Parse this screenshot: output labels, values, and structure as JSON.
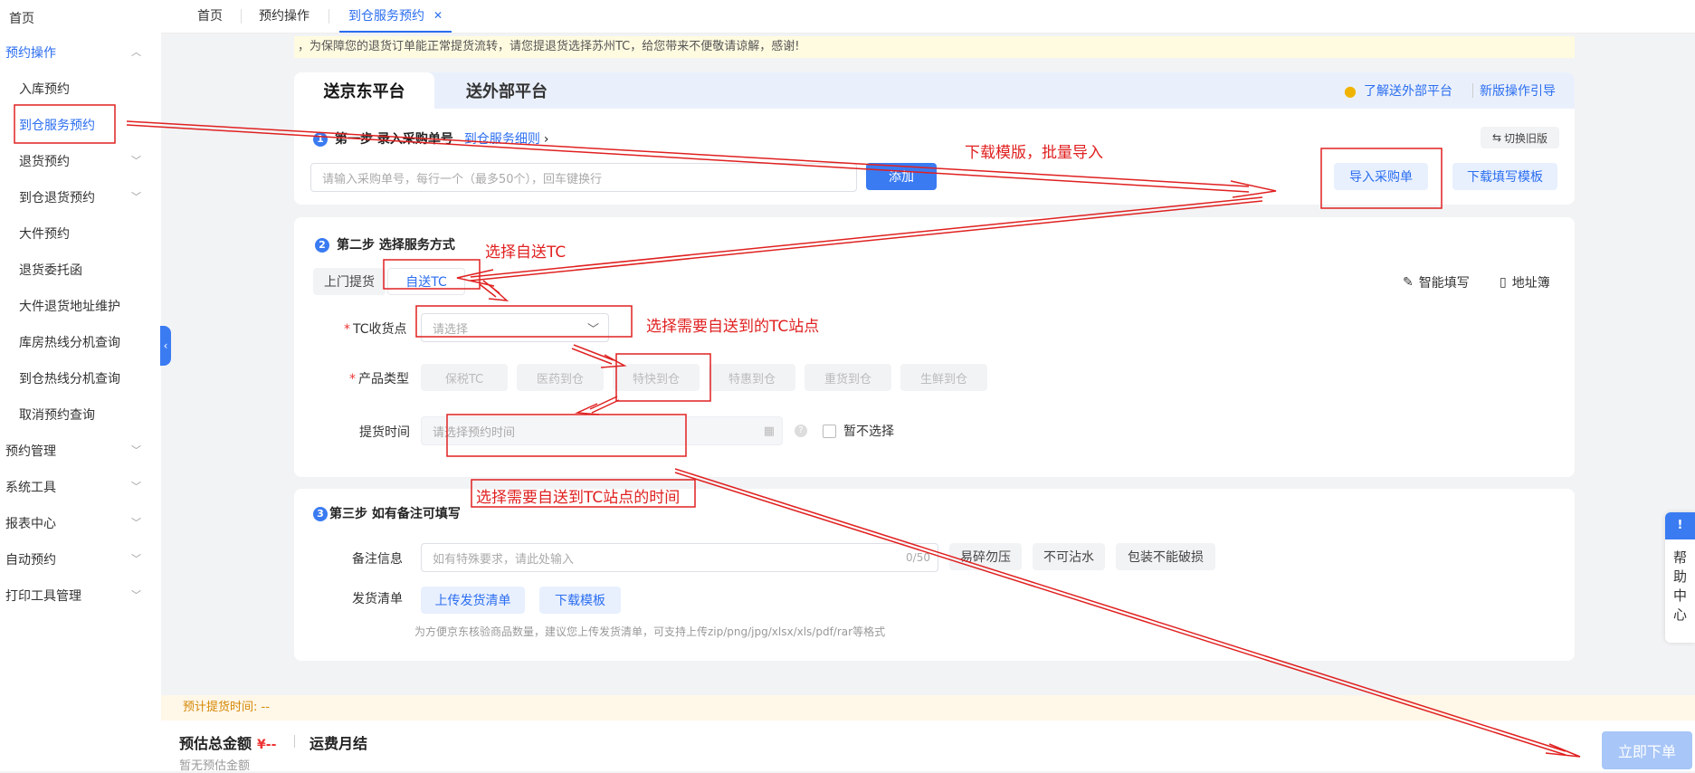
{
  "sidebar": {
    "items": [
      {
        "label": "首页"
      },
      {
        "label": "预约操作"
      },
      {
        "label": "入库预约"
      },
      {
        "label": "到仓服务预约"
      },
      {
        "label": "退货预约"
      },
      {
        "label": "到仓退货预约"
      },
      {
        "label": "大件预约"
      },
      {
        "label": "退货委托函"
      },
      {
        "label": "大件退货地址维护"
      },
      {
        "label": "库房热线分机查询"
      },
      {
        "label": "到仓热线分机查询"
      },
      {
        "label": "取消预约查询"
      },
      {
        "label": "预约管理"
      },
      {
        "label": "系统工具"
      },
      {
        "label": "报表中心"
      },
      {
        "label": "自动预约"
      },
      {
        "label": "打印工具管理"
      }
    ]
  },
  "tabs": [
    {
      "label": "首页"
    },
    {
      "label": "预约操作"
    },
    {
      "label": "到仓服务预约"
    }
  ],
  "notice": "，为保障您的退货订单能正常提货流转，请您提退货选择苏州TC，给您带来不便敬请谅解，感谢!",
  "platform": {
    "tab1": "送京东平台",
    "tab2": "送外部平台",
    "learn_link": "了解送外部平台",
    "guide_link": "新版操作引导"
  },
  "step1": {
    "title": "第一步 录入采购单号",
    "detail_link": "到仓服务细则",
    "switch_old": "切换旧版",
    "input_placeholder": "请输入采购单号，每行一个（最多50个），回车键换行",
    "add_button": "添加",
    "import_button": "导入采购单",
    "download_button": "下载填写模板"
  },
  "step2": {
    "title": "第二步 选择服务方式",
    "mode_pickup": "上门提货",
    "mode_self": "自送TC",
    "smart_fill": "智能填写",
    "address_book": "地址簿",
    "tc_label": "TC收货点",
    "tc_placeholder": "请选择",
    "product_label": "产品类型",
    "products": [
      "保税TC",
      "医药到仓",
      "特快到仓",
      "特惠到仓",
      "重货到仓",
      "生鲜到仓"
    ],
    "time_label": "提货时间",
    "time_placeholder": "请选择预约时间",
    "not_select": "暂不选择"
  },
  "step3": {
    "num": "3",
    "title": "第三步 如有备注可填写",
    "remark_label": "备注信息",
    "remark_placeholder": "如有特殊要求，请此处输入",
    "remark_count": "0/50",
    "tags": [
      "易碎勿压",
      "不可沾水",
      "包装不能破损"
    ],
    "ship_label": "发货清单",
    "upload_button": "上传发货清单",
    "download_button": "下载模板",
    "hint": "为方便京东核验商品数量，建议您上传发货清单，可支持上传zip/png/jpg/xlsx/xls/pdf/rar等格式"
  },
  "footer": {
    "estimate_time": "预计提货时间: --",
    "total_label": "预估总金额",
    "total_value": "¥--",
    "freight": "运费月结",
    "no_estimate": "暂无预估金额",
    "submit_button": "立即下单"
  },
  "help": {
    "label": "帮助中心",
    "chars": [
      "帮",
      "助",
      "中",
      "心"
    ]
  },
  "annotations": {
    "download_import": "下载模版，批量导入",
    "choose_self": "选择自送TC",
    "choose_station": "选择需要自送到的TC站点",
    "choose_time": "选择需要自送到TC站点的时间"
  },
  "colors": {
    "accent": "#3a7bf2",
    "annotation": "#e02020",
    "notice_bg": "#fffbe0"
  }
}
